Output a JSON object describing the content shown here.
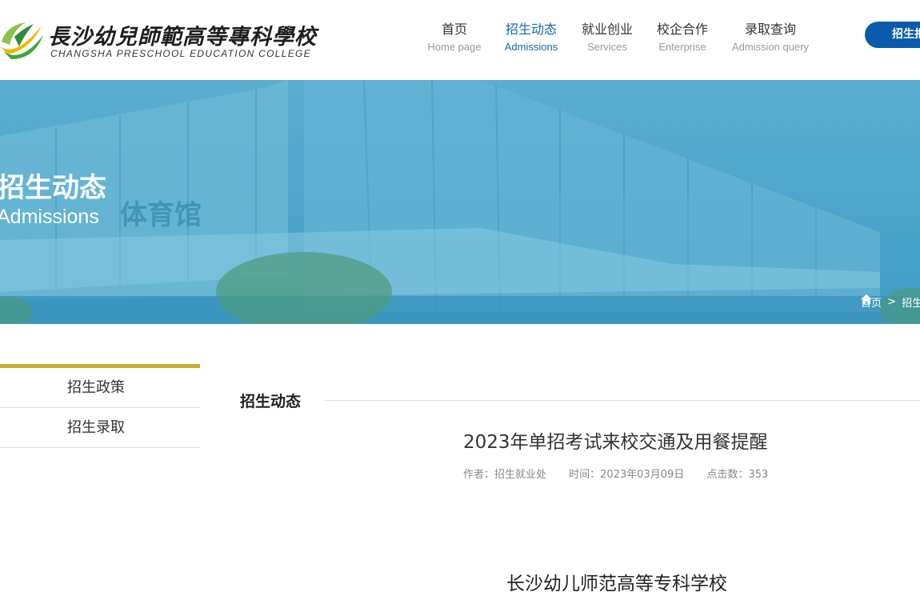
{
  "header": {
    "logo_cn": "長沙幼兒師範高等專科學校",
    "logo_en": "CHANGSHA  PRESCHOOL  EDUCATION  COLLEGE",
    "nav": [
      {
        "cn": "首页",
        "en": "Home page"
      },
      {
        "cn": "招生动态",
        "en": "Admissions"
      },
      {
        "cn": "就业创业",
        "en": "Services"
      },
      {
        "cn": "校企合作",
        "en": "Enterprise"
      },
      {
        "cn": "录取查询",
        "en": "Admission query"
      }
    ],
    "active_nav": "招生动态",
    "cta_label": "招生报名"
  },
  "banner": {
    "title_cn": "招生动态",
    "title_en": "Admissions",
    "building_sign": "体育馆",
    "breadcrumb_home": "首页",
    "breadcrumb_sep": ">",
    "breadcrumb_current": "招生动态"
  },
  "sidebar": {
    "items": [
      {
        "label": "招生政策"
      },
      {
        "label": "招生录取"
      }
    ]
  },
  "main": {
    "section_title": "招生动态",
    "article_title": "2023年单招考试来校交通及用餐提醒",
    "author": "作者：招生就业处",
    "time": "时间：2023年03月09日",
    "clicks": "点击数：353",
    "body_heading": "长沙幼儿师范高等专科学校"
  },
  "colors": {
    "accent_blue": "#1565a8",
    "cta_blue": "#0a5bab",
    "sidebar_gold": "#c9ad2c"
  }
}
